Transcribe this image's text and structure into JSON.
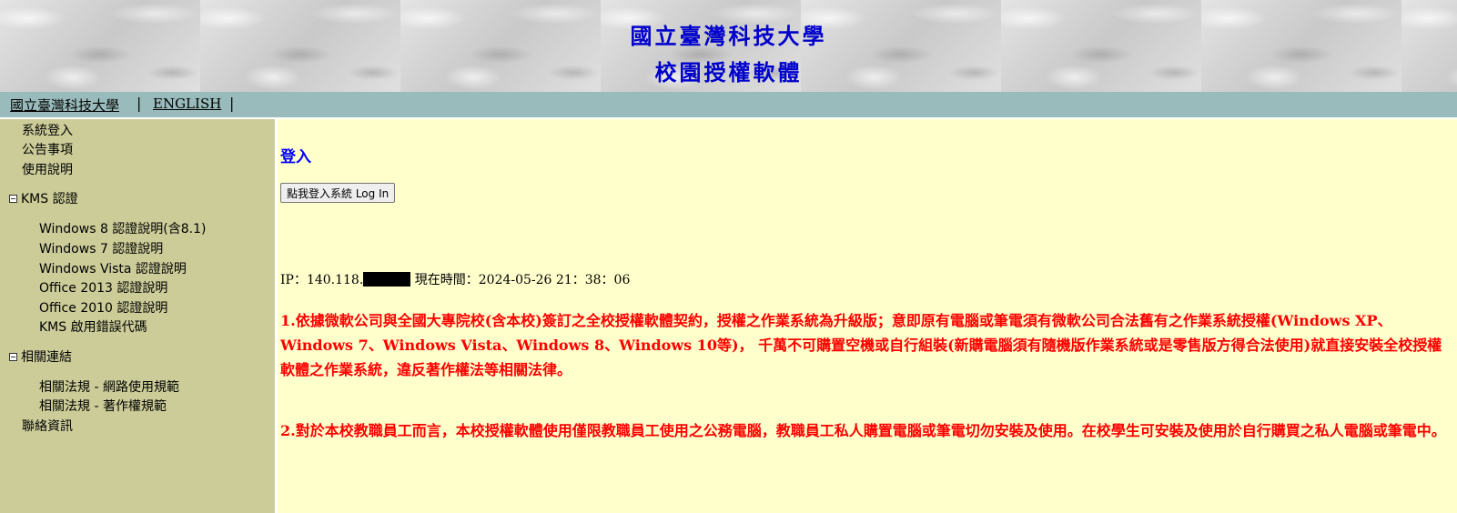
{
  "header": {
    "title_line1": "國立臺灣科技大學",
    "title_line2": "校園授權軟體"
  },
  "navbar": {
    "links": [
      "國立臺灣科技大學",
      "ENGLISH"
    ],
    "separator": "|"
  },
  "sidebar": {
    "top_items": [
      "系統登入",
      "公告事項",
      "使用說明"
    ],
    "kms_group": {
      "label": "KMS 認證",
      "items": [
        "Windows 8 認證說明(含8.1)",
        "Windows 7 認證說明",
        "Windows Vista 認證說明",
        "Office 2013 認證說明",
        "Office 2010 認證說明",
        "KMS 啟用錯誤代碼"
      ]
    },
    "links_group": {
      "label": "相關連結",
      "items": [
        "相關法規 - 網路使用規範",
        "相關法規 - 著作權規範"
      ]
    },
    "contact": "聯絡資訊"
  },
  "main": {
    "heading": "登入",
    "login_button": "點我登入系統 Log In",
    "ip_label": "IP：140.118.",
    "time_text": "現在時間：2024-05-26 21：38：06",
    "notice1": "1.依據微軟公司與全國大專院校(含本校)簽訂之全校授權軟體契約，授權之作業系統為升級版；意即原有電腦或筆電須有微軟公司合法舊有之作業系統授權(Windows XP、Windows 7、Windows Vista、Windows 8、Windows 10等)， 千萬不可購置空機或自行組裝(新購電腦須有隨機版作業系統或是零售版方得合法使用)就直接安裝全校授權軟體之作業系統，違反著作權法等相關法律。",
    "notice2": "2.對於本校教職員工而言，本校授權軟體使用僅限教職員工使用之公務電腦，教職員工私人購置電腦或筆電切勿安裝及使用。在校學生可安裝及使用於自行購買之私人電腦或筆電中。"
  },
  "colors": {
    "title_blue": "#0000cc",
    "navbar_bg": "#99bbbb",
    "sidebar_bg": "#cccc99",
    "main_bg": "#ffffcc",
    "notice_red": "#ff0000"
  }
}
